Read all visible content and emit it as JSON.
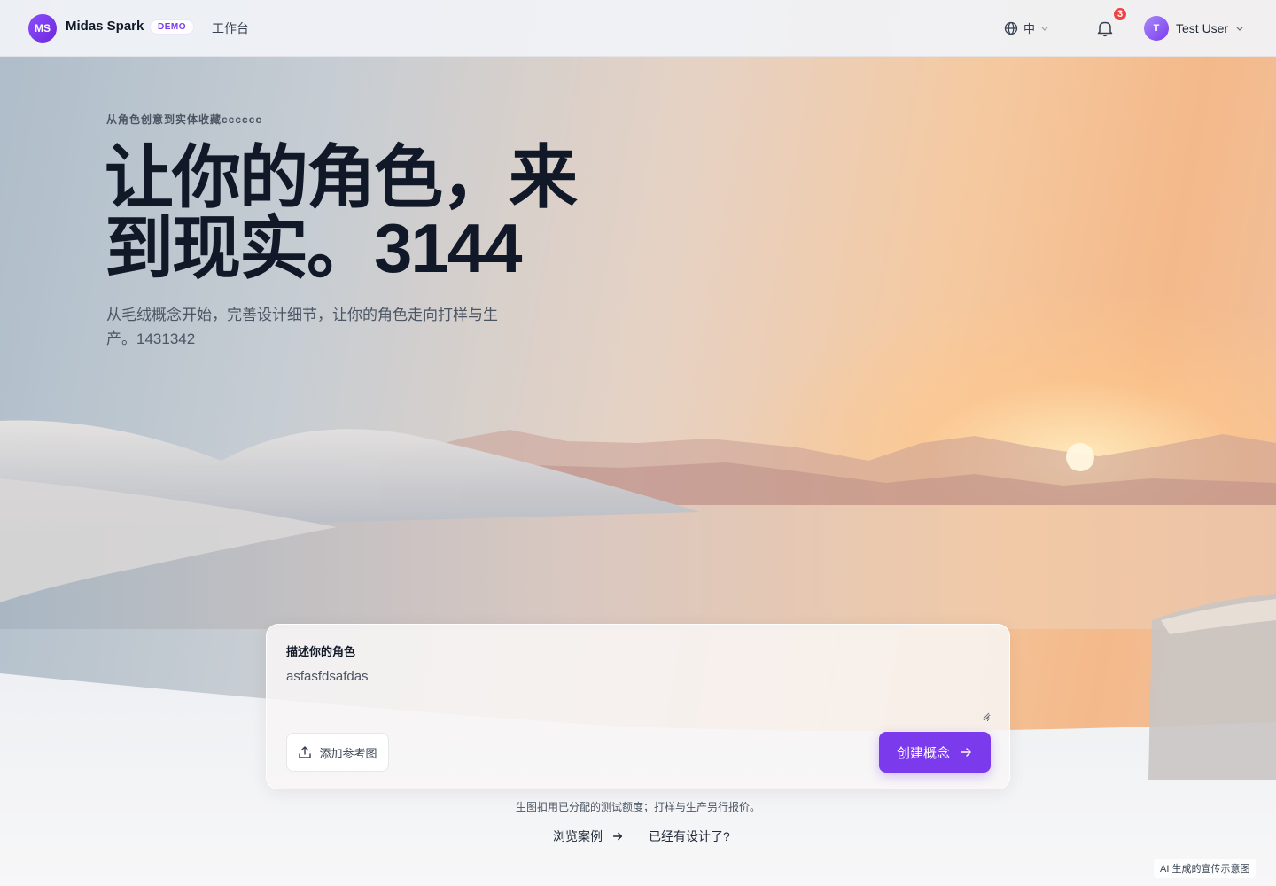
{
  "header": {
    "logo_initials": "MS",
    "brand": "Midas Spark",
    "badge": "DEMO",
    "nav_workbench": "工作台",
    "language": "中",
    "notification_count": "3",
    "user_initial": "T",
    "user_name": "Test User",
    "icons": [
      "globe-icon",
      "chevron-down-icon",
      "bell-icon"
    ]
  },
  "hero": {
    "eyebrow": "从角色创意到实体收藏cccccc",
    "title_line1": "让你的角色，来",
    "title_line2": "到现实。3144",
    "subtitle": "从毛绒概念开始，完善设计细节，让你的角色走向打样与生产。1431342"
  },
  "prompt": {
    "label": "描述你的角色",
    "value": "asfasfdsafdas",
    "upload_label": "添加参考图",
    "create_label": "创建概念"
  },
  "footer": {
    "note": "生图扣用已分配的测试额度；打样与生产另行报价。",
    "browse_label": "浏览案例",
    "have_design_label": "已经有设计了?",
    "ai_tag": "AI 生成的宣传示意图"
  },
  "colors": {
    "accent": "#7c3aed",
    "notification": "#ef4444",
    "title": "#111827"
  }
}
